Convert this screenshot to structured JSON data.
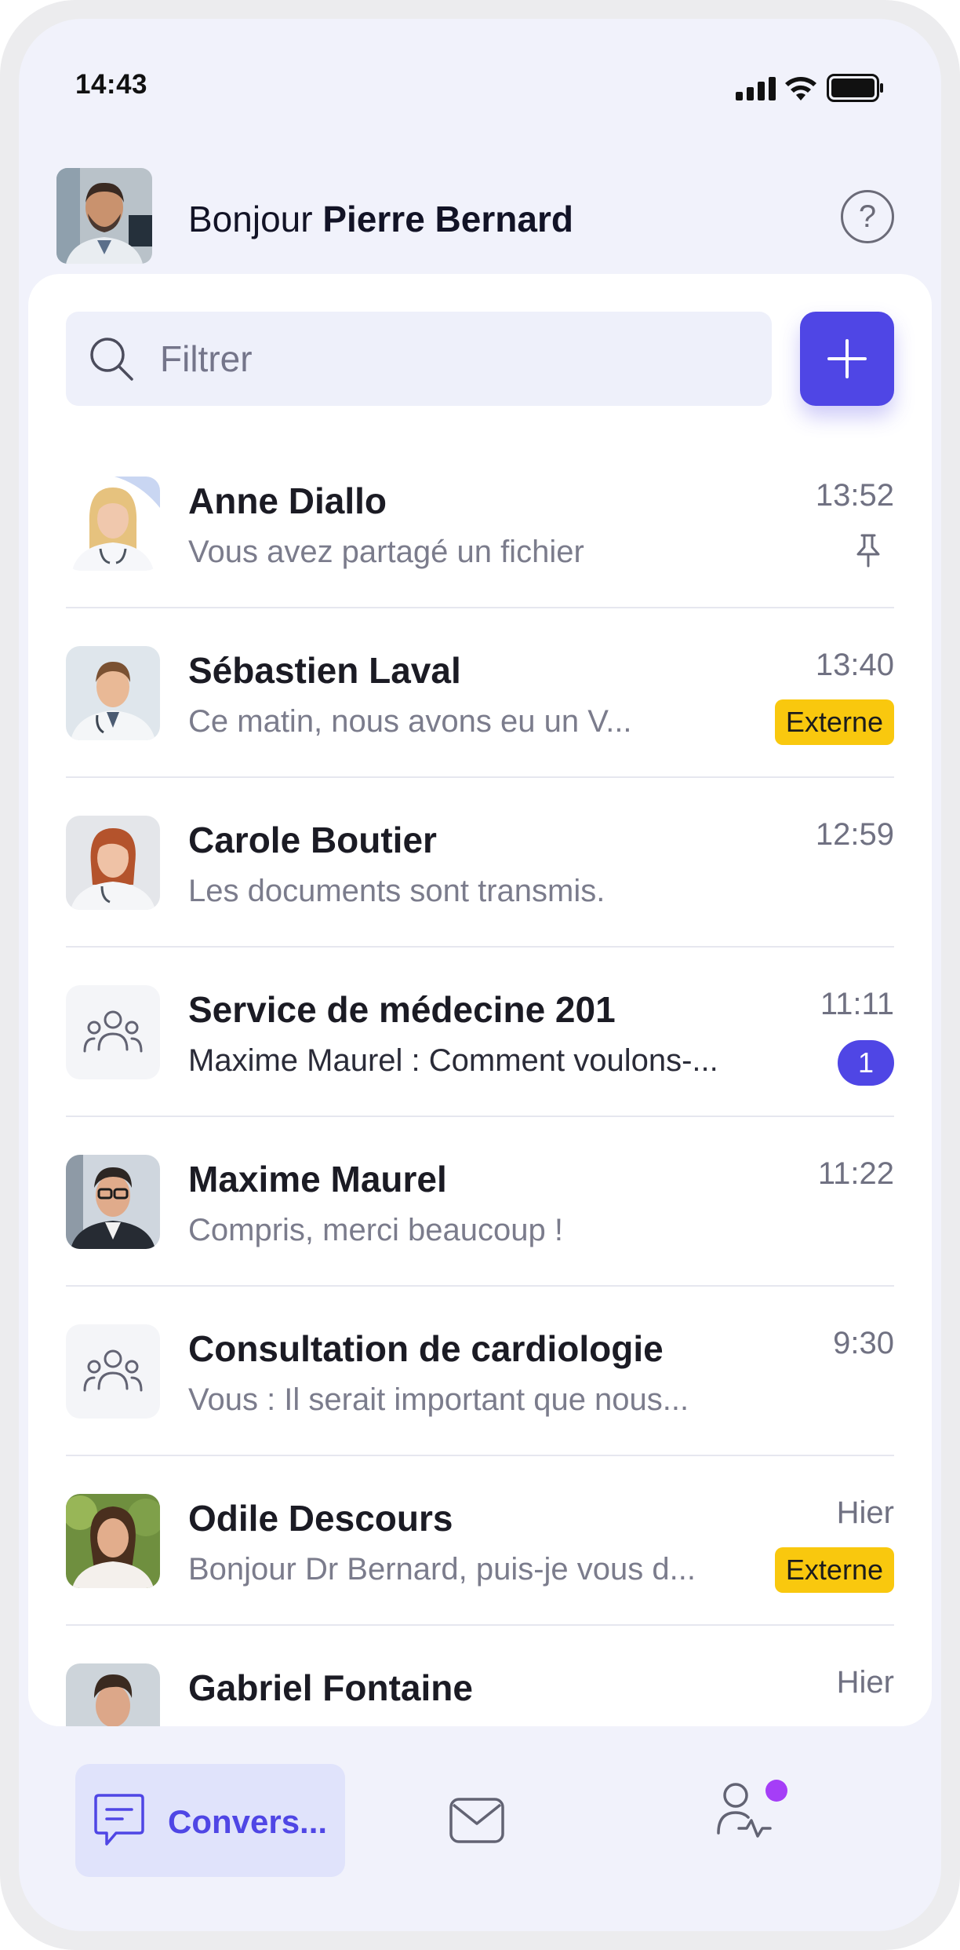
{
  "status_bar": {
    "time": "14:43"
  },
  "header": {
    "greeting_prefix": "Bonjour",
    "user_name": "Pierre Bernard",
    "help_symbol": "?"
  },
  "search": {
    "placeholder": "Filtrer"
  },
  "conversations": [
    {
      "name": "Anne Diallo",
      "preview": "Vous avez partagé un fichier",
      "time": "13:52",
      "indicator": "pin"
    },
    {
      "name": "Sébastien Laval",
      "preview": "Ce matin, nous avons eu un V...",
      "time": "13:40",
      "badge": "Externe"
    },
    {
      "name": "Carole Boutier",
      "preview": "Les documents sont transmis.",
      "time": "12:59"
    },
    {
      "name": "Service de médecine 201",
      "preview": "Maxime Maurel : Comment voulons-...",
      "time": "11:11",
      "unread": "1"
    },
    {
      "name": "Maxime Maurel",
      "preview": "Compris, merci beaucoup !",
      "time": "11:22"
    },
    {
      "name": "Consultation de cardiologie",
      "preview": "Vous : Il serait important que nous...",
      "time": "9:30"
    },
    {
      "name": "Odile Descours",
      "preview": "Bonjour Dr Bernard, puis-je vous d...",
      "time": "Hier",
      "badge": "Externe"
    },
    {
      "name": "Gabriel Fontaine",
      "preview": "",
      "time": "Hier"
    }
  ],
  "bottom_nav": {
    "conversations_label": "Convers..."
  },
  "colors": {
    "accent": "#4f46e5",
    "external_badge": "#f9c80e",
    "notification_dot": "#a53ef7",
    "background": "#f1f2fb"
  }
}
